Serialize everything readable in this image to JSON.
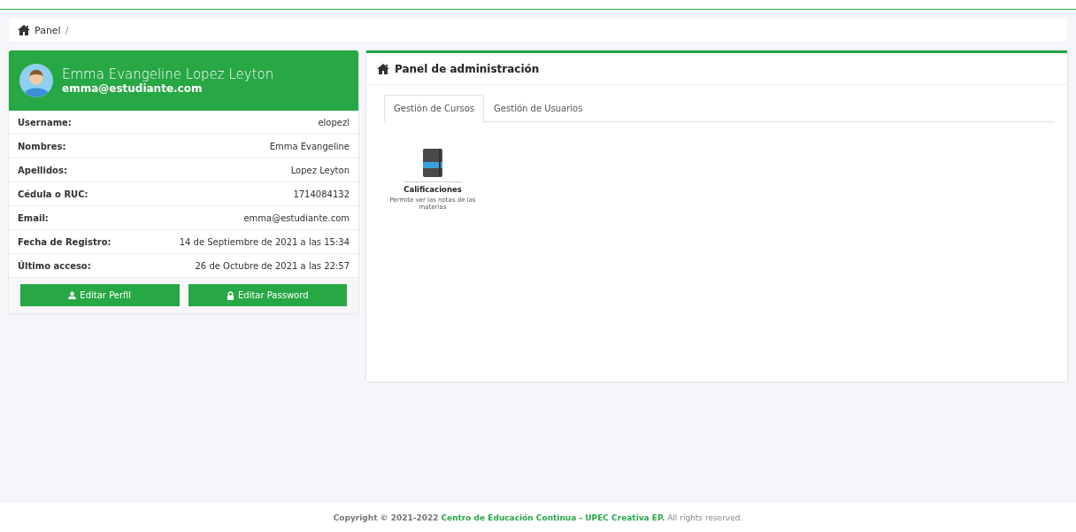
{
  "breadcrumb": {
    "items": [
      "Panel",
      "/"
    ]
  },
  "profile": {
    "name": "Emma Evangeline Lopez Leyton",
    "email": "emma@estudiante.com",
    "fields": [
      {
        "label": "Username:",
        "value": "elopezl"
      },
      {
        "label": "Nombres:",
        "value": "Emma Evangeline"
      },
      {
        "label": "Apellidos:",
        "value": "Lopez Leyton"
      },
      {
        "label": "Cédula o RUC:",
        "value": "1714084132"
      },
      {
        "label": "Email:",
        "value": "emma@estudiante.com"
      },
      {
        "label": "Fecha de Registro:",
        "value": "14 de Septiembre de 2021 a las 15:34"
      },
      {
        "label": "Último acceso:",
        "value": "26 de Octubre de 2021 a las 22:57"
      }
    ],
    "buttons": [
      {
        "label": "Editar Perfil",
        "kind": "user"
      },
      {
        "label": "Editar Password",
        "kind": "lock"
      }
    ]
  },
  "admin_panel": {
    "title": "Panel de administración",
    "tabs": [
      {
        "label": "Gestión de Cursos",
        "selected": true
      },
      {
        "label": "Gestión de Usuarios",
        "selected": false
      }
    ],
    "modules": [
      {
        "title": "Calificaciones",
        "description": "Permite ver las notas de las materias"
      }
    ]
  },
  "footer": {
    "prefix": "Copyright © 2021-2022",
    "link": "Centro de Educación Continua - UPEC Creativa EP.",
    "suffix": "All rights reserved."
  }
}
